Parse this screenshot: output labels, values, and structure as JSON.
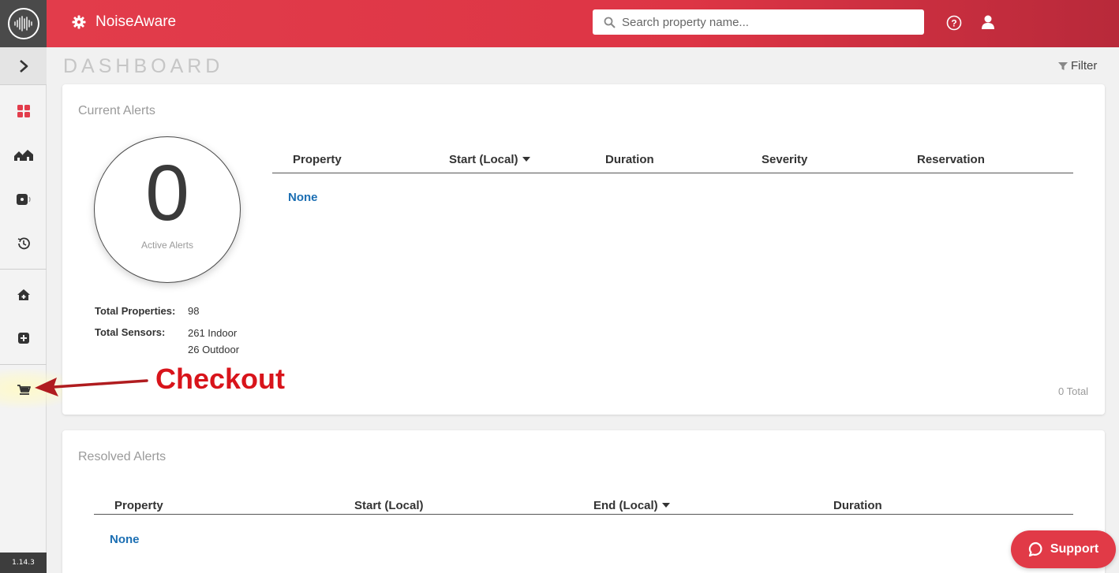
{
  "app": {
    "brand_name": "NoiseAware",
    "version": "1.14.3"
  },
  "colors": {
    "brand_red": "#e23c4b",
    "link_blue": "#1c6fb3",
    "nav_active_red": "#e23c4b",
    "annotation_red": "#d8141b"
  },
  "header": {
    "search_placeholder": "Search property name...",
    "help_icon": "help-circle-icon",
    "user_icon": "user-icon"
  },
  "sidebar": {
    "logo_icon": "soundwave-logo-icon",
    "expand_icon": "chevron-right-icon",
    "items": [
      {
        "icon": "dashboard-grid-icon",
        "active": true
      },
      {
        "icon": "properties-icon",
        "active": false
      },
      {
        "icon": "sensor-icon",
        "active": false
      },
      {
        "icon": "history-icon",
        "active": false
      },
      {
        "icon": "add-property-icon",
        "active": false
      },
      {
        "icon": "add-sensor-icon",
        "active": false
      },
      {
        "icon": "cart-icon",
        "active": false
      }
    ]
  },
  "page": {
    "title": "DASHBOARD",
    "filter_label": "Filter"
  },
  "current_alerts": {
    "title": "Current Alerts",
    "active_count": "0",
    "active_label": "Active Alerts",
    "total_properties_label": "Total Properties:",
    "total_properties_value": "98",
    "total_sensors_label": "Total Sensors:",
    "sensors_indoor": "261 Indoor",
    "sensors_outdoor": "26 Outdoor",
    "columns": [
      "Property",
      "Start (Local)",
      "Duration",
      "Severity",
      "Reservation"
    ],
    "sorted_column": "Start (Local)",
    "empty_text": "None",
    "total_text": "0 Total"
  },
  "resolved_alerts": {
    "title": "Resolved Alerts",
    "columns": [
      "Property",
      "Start (Local)",
      "End (Local)",
      "Duration"
    ],
    "sorted_column": "End (Local)",
    "empty_text": "None"
  },
  "annotation": {
    "label": "Checkout"
  },
  "support": {
    "label": "Support"
  }
}
